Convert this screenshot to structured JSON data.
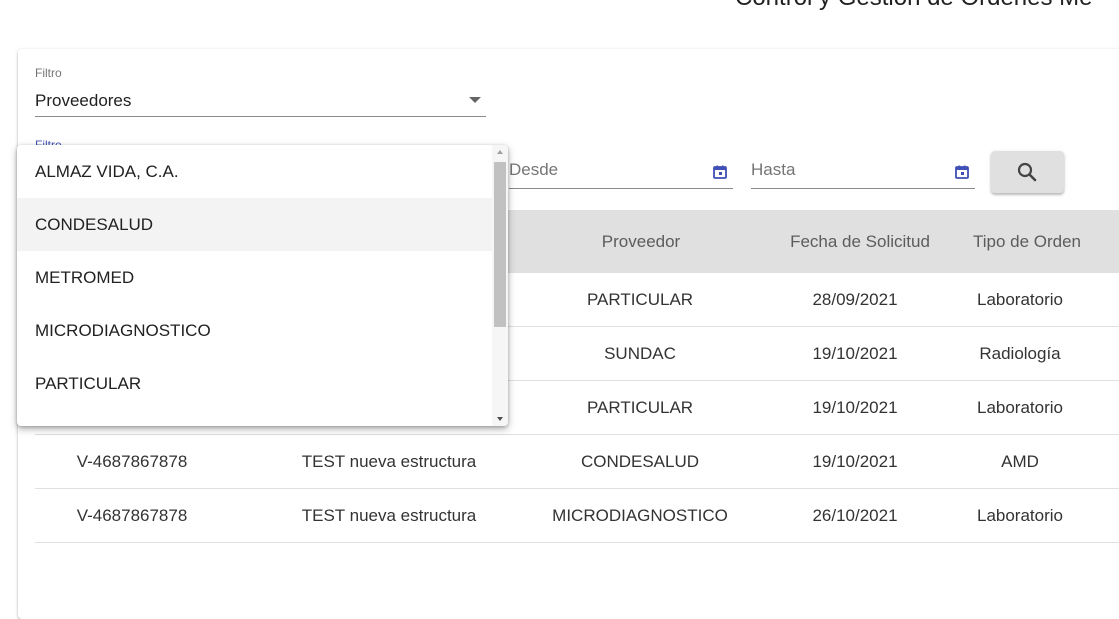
{
  "page": {
    "title": "Control y Gestión de Órdenes Mé"
  },
  "filter": {
    "label": "Filtro",
    "selected": "Proveedores",
    "secondary_label": "Filtro"
  },
  "dates": {
    "from_placeholder": "Desde",
    "to_placeholder": "Hasta",
    "icon": "calendar-icon",
    "icon_color": "#3f51b5"
  },
  "search": {
    "icon": "search-icon"
  },
  "dropdown": {
    "options": [
      "ALMAZ VIDA, C.A.",
      "CONDESALUD",
      "METROMED",
      "MICRODIAGNOSTICO",
      "PARTICULAR"
    ],
    "highlighted": "CONDESALUD"
  },
  "table": {
    "headers": [
      "Proveedor",
      "Fecha de Solicitud",
      "Tipo de Orden"
    ],
    "rows": [
      {
        "cedula": "",
        "nombre": "",
        "proveedor": "PARTICULAR",
        "fecha": "28/09/2021",
        "tipo": "Laboratorio"
      },
      {
        "cedula": "",
        "nombre": "",
        "proveedor": "SUNDAC",
        "fecha": "19/10/2021",
        "tipo": "Radiología"
      },
      {
        "cedula": "",
        "nombre": "",
        "proveedor": "PARTICULAR",
        "fecha": "19/10/2021",
        "tipo": "Laboratorio"
      },
      {
        "cedula": "V-4687867878",
        "nombre": "TEST nueva estructura",
        "proveedor": "CONDESALUD",
        "fecha": "19/10/2021",
        "tipo": "AMD"
      },
      {
        "cedula": "V-4687867878",
        "nombre": "TEST nueva estructura",
        "proveedor": "MICRODIAGNOSTICO",
        "fecha": "26/10/2021",
        "tipo": "Laboratorio"
      }
    ]
  },
  "colors": {
    "accent": "#3f51b5",
    "header_bg": "#e0e0e0",
    "highlight": "#f3f3f3"
  }
}
